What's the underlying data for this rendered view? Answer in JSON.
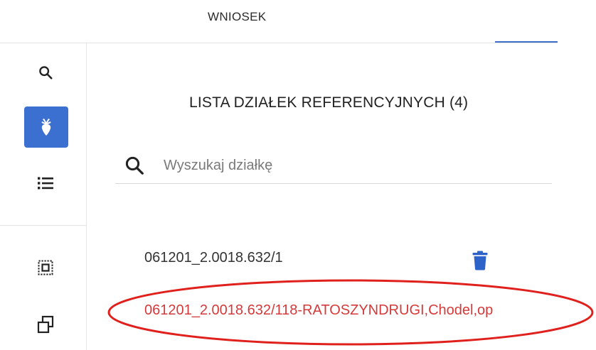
{
  "header": {
    "tab_label": "WNIOSEK"
  },
  "rail": {
    "icons": [
      "search-icon",
      "parcel-icon",
      "list-icon",
      "select-area-icon",
      "copy-icon"
    ],
    "active_color": "#3b6fd0"
  },
  "panel": {
    "title": "LISTA DZIAŁEK REFERENCYJNYCH (4)",
    "search_placeholder": "Wyszukaj działkę",
    "items": [
      {
        "label": "061201_2.0018.632/1"
      },
      {
        "label": "061201_2.0018.632/118-RATOSZYNDRUGI,Chodel,op",
        "highlighted": true
      }
    ]
  },
  "colors": {
    "accent": "#3b6fd0",
    "delete_icon": "#2d63c8",
    "error_text": "#d43a3a",
    "annotation_ellipse": "#e0201c"
  }
}
